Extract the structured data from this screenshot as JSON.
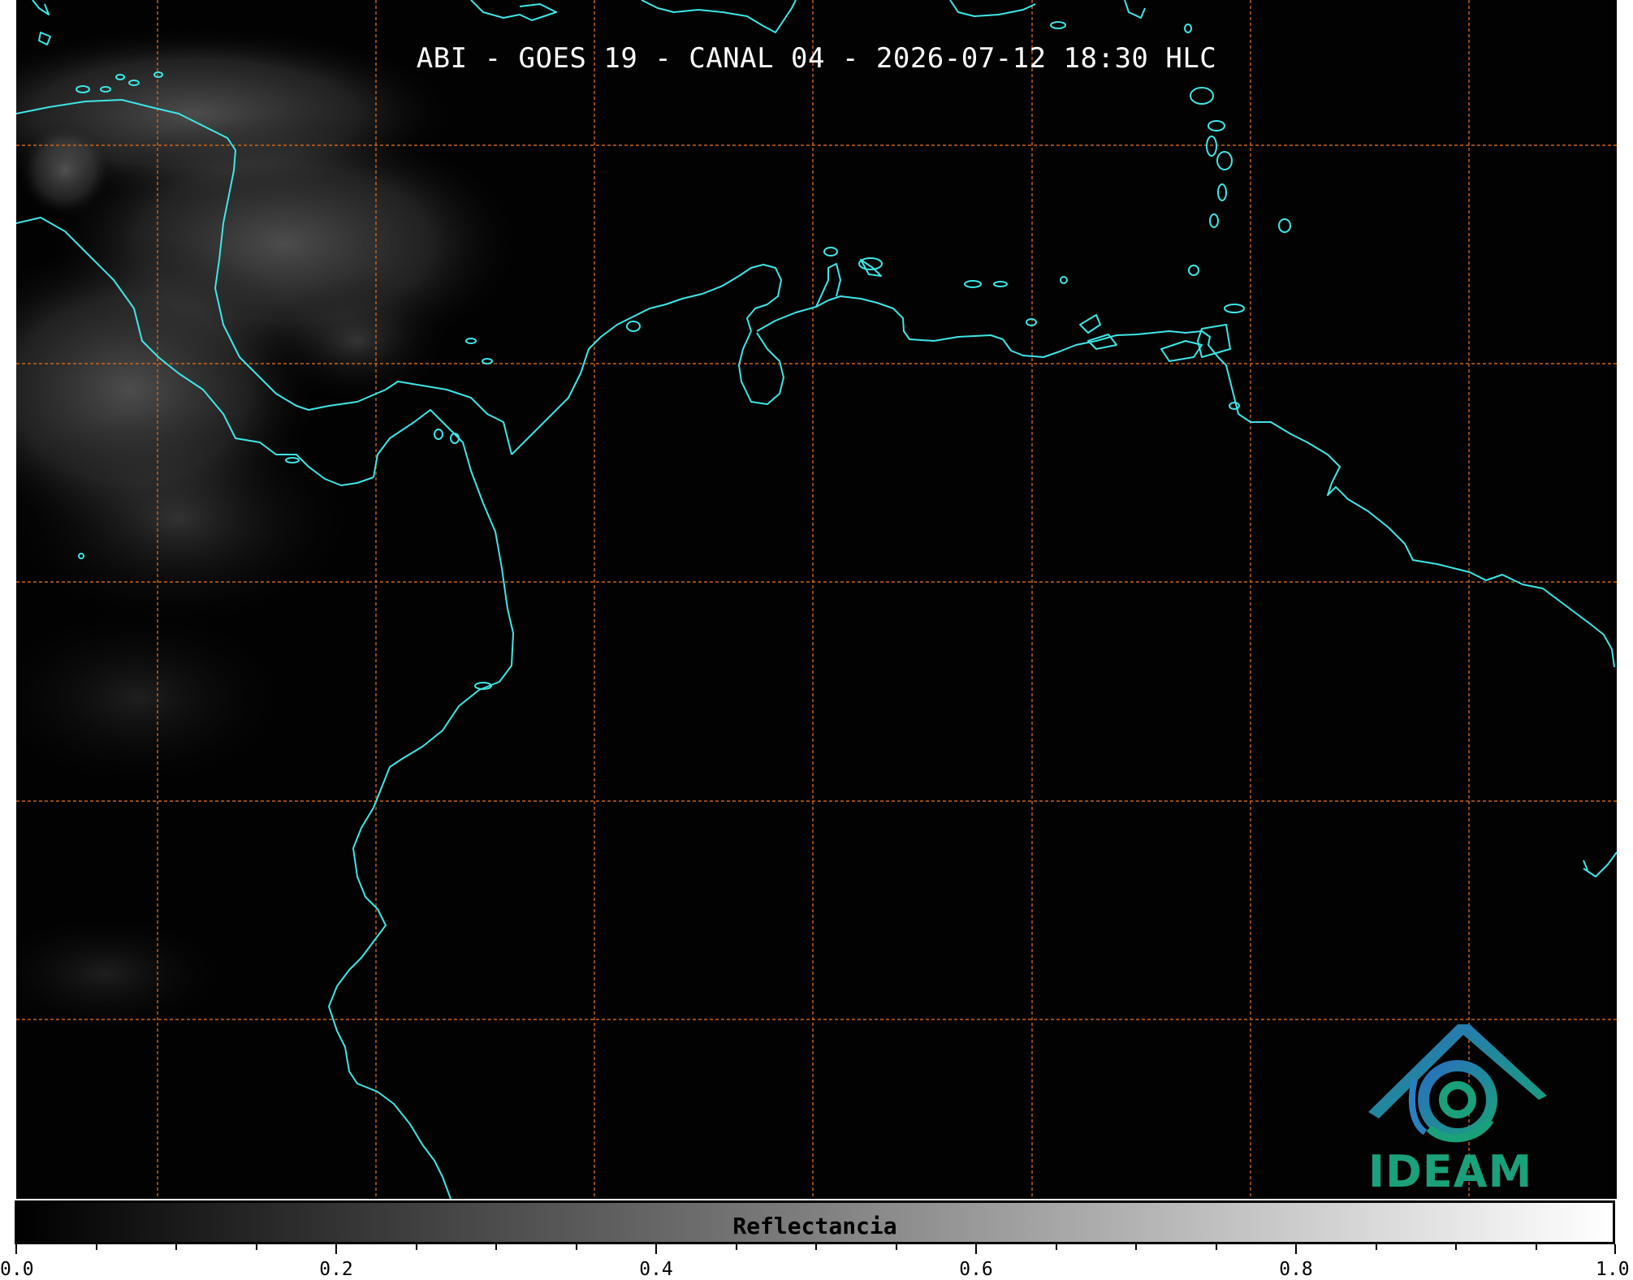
{
  "title": "ABI - GOES 19 - CANAL 04 - 2026-07-12 18:30 HLC",
  "logo": {
    "text": "IDEAM"
  },
  "colorbar": {
    "label": "Reflectancia",
    "ticks": [
      "0.0",
      "0.2",
      "0.4",
      "0.6",
      "0.8",
      "1.0"
    ],
    "min": 0.0,
    "max": 1.0
  },
  "colors": {
    "coastline": "#3fe6e6",
    "grid": "#c8651e",
    "background": "#020202",
    "logo_green": "#1aa07a",
    "logo_blue": "#2a7fbf"
  }
}
